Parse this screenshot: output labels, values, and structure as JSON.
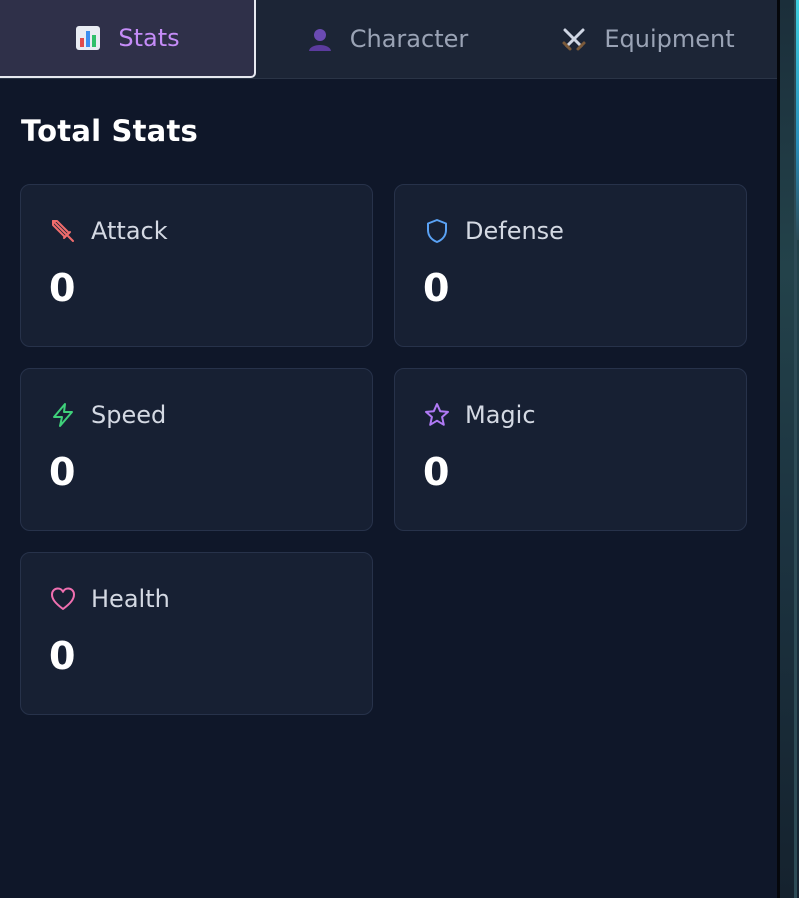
{
  "tabs": [
    {
      "label": "Stats",
      "icon": "bar-chart-icon",
      "active": true
    },
    {
      "label": "Character",
      "icon": "person-icon",
      "active": false
    },
    {
      "label": "Equipment",
      "icon": "crossed-swords-icon",
      "active": false
    }
  ],
  "section_title": "Total Stats",
  "stats": [
    {
      "label": "Attack",
      "value": "0",
      "icon": "sword-icon",
      "color": "#f06c6c"
    },
    {
      "label": "Defense",
      "value": "0",
      "icon": "shield-icon",
      "color": "#5aa2f5"
    },
    {
      "label": "Speed",
      "value": "0",
      "icon": "lightning-icon",
      "color": "#3fd07a"
    },
    {
      "label": "Magic",
      "value": "0",
      "icon": "star-icon",
      "color": "#b07af5"
    },
    {
      "label": "Health",
      "value": "0",
      "icon": "heart-icon",
      "color": "#f06fb0"
    }
  ],
  "colors": {
    "background": "#0f1729",
    "card": "#172033",
    "tabbar": "#1c2536",
    "active_tab_text": "#c58cf8"
  }
}
